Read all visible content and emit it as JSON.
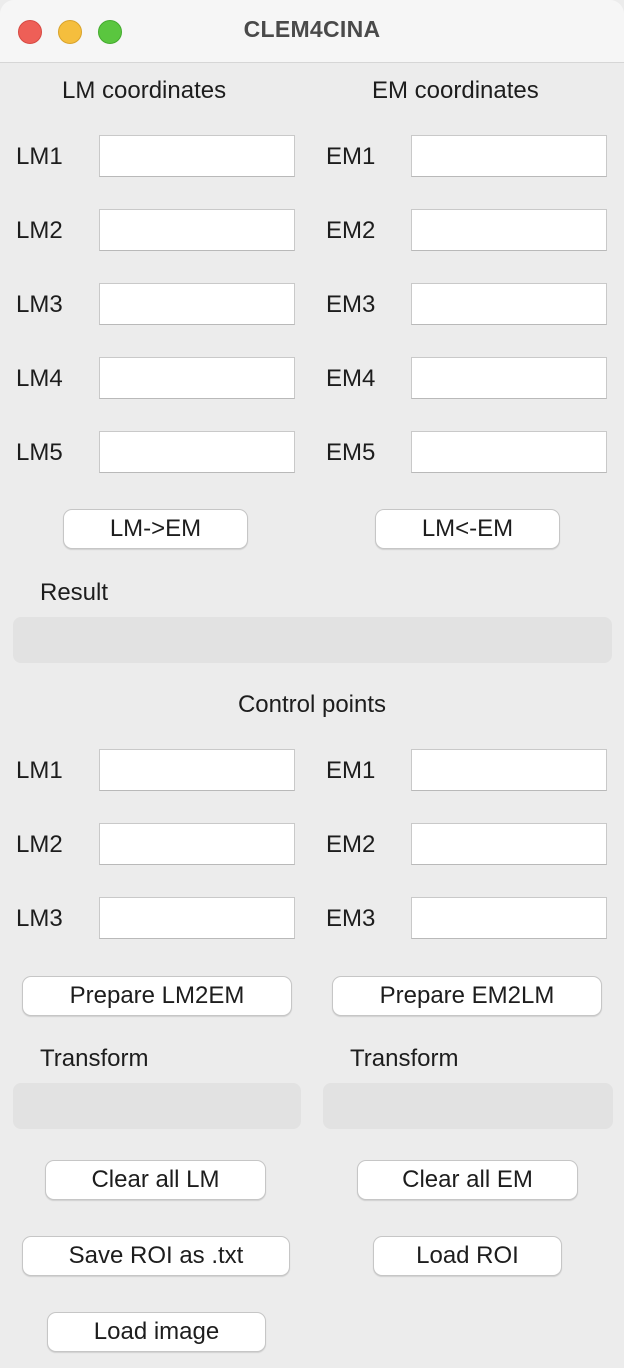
{
  "window": {
    "title": "CLEM4CINA"
  },
  "coords": {
    "lm_header": "LM coordinates",
    "em_header": "EM coordinates",
    "lm": [
      {
        "label": "LM1",
        "value": ""
      },
      {
        "label": "LM2",
        "value": ""
      },
      {
        "label": "LM3",
        "value": ""
      },
      {
        "label": "LM4",
        "value": ""
      },
      {
        "label": "LM5",
        "value": ""
      }
    ],
    "em": [
      {
        "label": "EM1",
        "value": ""
      },
      {
        "label": "EM2",
        "value": ""
      },
      {
        "label": "EM3",
        "value": ""
      },
      {
        "label": "EM4",
        "value": ""
      },
      {
        "label": "EM5",
        "value": ""
      }
    ],
    "lm_to_em_button": "LM->EM",
    "em_to_lm_button": "LM<-EM",
    "result_label": "Result",
    "result_value": ""
  },
  "control": {
    "header": "Control points",
    "lm": [
      {
        "label": "LM1",
        "value": ""
      },
      {
        "label": "LM2",
        "value": ""
      },
      {
        "label": "LM3",
        "value": ""
      }
    ],
    "em": [
      {
        "label": "EM1",
        "value": ""
      },
      {
        "label": "EM2",
        "value": ""
      },
      {
        "label": "EM3",
        "value": ""
      }
    ],
    "prepare_lm2em_button": "Prepare LM2EM",
    "prepare_em2lm_button": "Prepare EM2LM",
    "transform_lm_label": "Transform",
    "transform_em_label": "Transform",
    "transform_lm_value": "",
    "transform_em_value": ""
  },
  "actions": {
    "clear_lm_button": "Clear all LM",
    "clear_em_button": "Clear all EM",
    "save_roi_button": "Save ROI as .txt",
    "load_roi_button": "Load ROI",
    "load_image_button": "Load image"
  }
}
